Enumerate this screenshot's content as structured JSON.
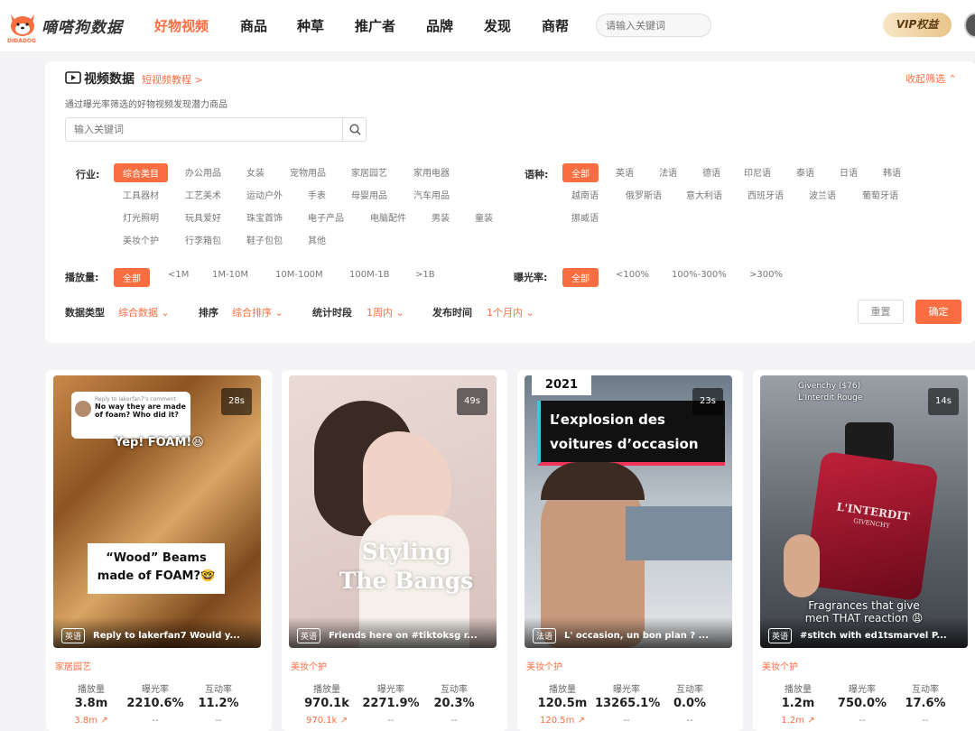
{
  "brand": {
    "name": "嘀嗒狗数据",
    "sub": "DIDADOG",
    "accent": "#f96e41"
  },
  "nav": [
    "好物视频",
    "商品",
    "种草",
    "推广者",
    "品牌",
    "发现",
    "商帮"
  ],
  "search_top": {
    "placeholder": "请输入关键词"
  },
  "vip": "VIP权益",
  "panel": {
    "title": "视频数据",
    "tutorial": "短视频教程 >",
    "subtitle": "通过曝光率筛选的好物视频发现潜力商品",
    "collapse": "收起筛选",
    "search": {
      "placeholder": "输入关键词"
    },
    "industry": {
      "label": "行业:",
      "items": [
        "综合类目",
        "办公用品",
        "女装",
        "宠物用品",
        "家居园艺",
        "家用电器",
        "工具器材",
        "工艺美术",
        "运动户外",
        "手表",
        "母婴用品",
        "汽车用品",
        "灯光照明",
        "玩具爱好",
        "珠宝首饰",
        "电子产品",
        "电脑配件",
        "男装",
        "童装",
        "美妆个护",
        "行李箱包",
        "鞋子包包",
        "其他"
      ]
    },
    "language": {
      "label": "语种:",
      "items": [
        "全部",
        "英语",
        "法语",
        "德语",
        "印尼语",
        "泰语",
        "日语",
        "韩语",
        "越南语",
        "俄罗斯语",
        "意大利语",
        "西班牙语",
        "波兰语",
        "葡萄牙语",
        "挪威语"
      ]
    },
    "plays": {
      "label": "播放量:",
      "items": [
        "全部",
        "<1M",
        "1M-10M",
        "10M-100M",
        "100M-1B",
        ">1B"
      ]
    },
    "exposure": {
      "label": "曝光率:",
      "items": [
        "全部",
        "<100%",
        "100%-300%",
        ">300%"
      ]
    },
    "dropdowns": [
      {
        "label": "数据类型",
        "value": "综合数据"
      },
      {
        "label": "排序",
        "value": "综合排序"
      },
      {
        "label": "统计时段",
        "value": "1周内"
      },
      {
        "label": "发布时间",
        "value": "1个月内"
      }
    ],
    "reset": "重置",
    "confirm": "确定"
  },
  "metric_labels": [
    "播放量",
    "曝光率",
    "互动率"
  ],
  "cards": [
    {
      "duration": "28s",
      "lang": "英语",
      "title": "Reply to lakerfan7 Would y...",
      "overlay": "“Wood” Beams made of FOAM?🤓",
      "overlay2": "Yep! FOAM!😆",
      "comment_head": "Reply to lakerfan7's comment",
      "comment": "No way they are made of foam? Who did it?",
      "category": "家居园艺",
      "plays": "3.8m",
      "exposure": "2210.6%",
      "interaction": "11.2%",
      "plays_sub": "3.8m",
      "exp_sub": "--",
      "int_sub": "--"
    },
    {
      "duration": "49s",
      "lang": "英语",
      "title": "Friends here on #tiktoksg r...",
      "overlay": "Styling The Bangs",
      "category": "美妆个护",
      "plays": "970.1k",
      "exposure": "2271.9%",
      "interaction": "20.3%",
      "plays_sub": "970.1k",
      "exp_sub": "--",
      "int_sub": "--"
    },
    {
      "duration": "23s",
      "lang": "法语",
      "title": "L' occasion, un bon plan ? ...",
      "overlay": "L’explosion des voitures d’occasion",
      "year": "2021",
      "category": "美妆个护",
      "plays": "120.5m",
      "exposure": "13265.1%",
      "interaction": "0.0%",
      "plays_sub": "120.5m",
      "exp_sub": "--",
      "int_sub": "--"
    },
    {
      "duration": "14s",
      "lang": "英语",
      "title": "#stitch with ed1tsmarvel P...",
      "overlay": "Fragrances that give men THAT reaction 😩",
      "brandtext": "Givenchy ($76) L'Interdit Rouge",
      "bottle": "L'INTERDIT",
      "bottle2": "GIVENCHY",
      "category": "美妆个护",
      "plays": "1.2m",
      "exposure": "750.0%",
      "interaction": "17.6%",
      "plays_sub": "1.2m",
      "exp_sub": "--",
      "int_sub": "--"
    }
  ]
}
